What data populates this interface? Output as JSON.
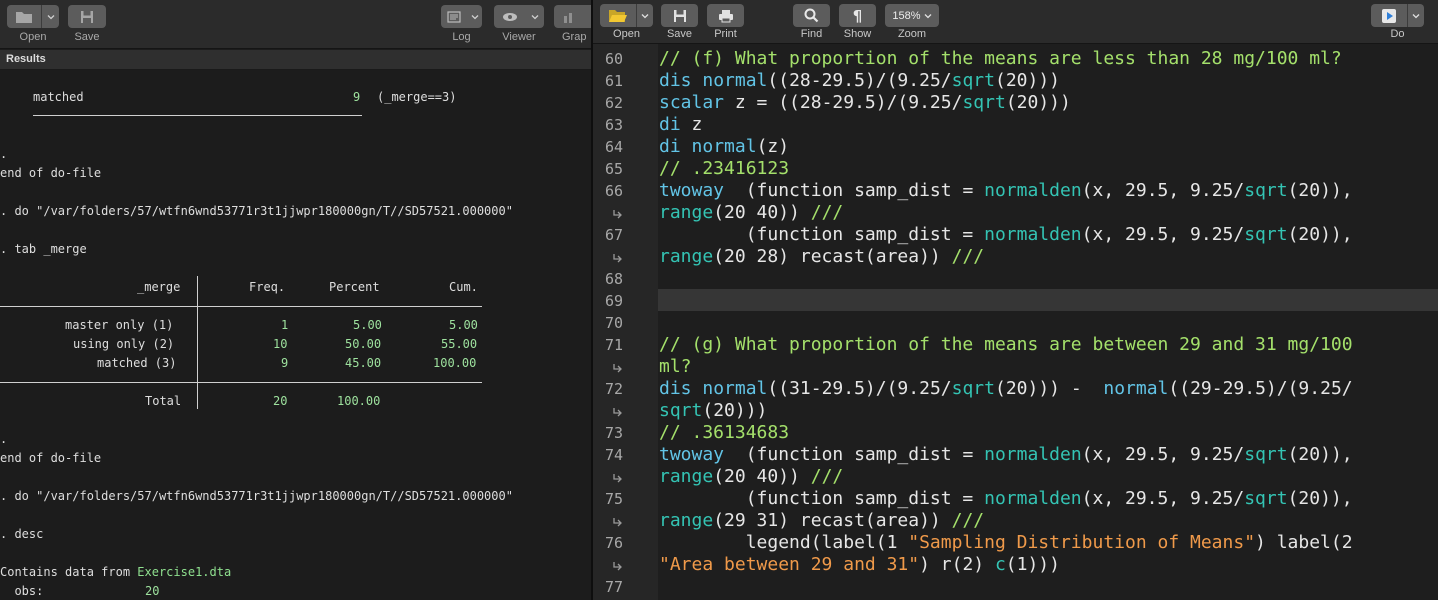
{
  "results_window": {
    "toolbar": {
      "open_label": "Open",
      "save_label": "Save",
      "log_label": "Log",
      "viewer_label": "Viewer",
      "graph_label": "Grap"
    },
    "results_header": "Results",
    "lines": {
      "merge_matched_label": "matched",
      "merge_matched_count": "9",
      "merge_matched_cond": "(_merge==3)",
      "dot1": ".",
      "end1": "end of do-file",
      "do1": ". do \"/var/folders/57/wtfn6wnd53771r3t1jjwpr180000gn/T//SD57521.000000\"",
      "tab_cmd": ". tab _merge",
      "dot2": ".",
      "end2": "end of do-file",
      "do2": ". do \"/var/folders/57/wtfn6wnd53771r3t1jjwpr180000gn/T//SD57521.000000\"",
      "desc_cmd": ". desc",
      "contains_prefix": "Contains data from ",
      "contains_file": "Exercise1.dta",
      "obs_label": "  obs:",
      "obs_value": "20"
    },
    "table": {
      "headers": [
        "_merge",
        "Freq.",
        "Percent",
        "Cum."
      ],
      "rows": [
        {
          "label": "master only (1)",
          "freq": "1",
          "percent": "5.00",
          "cum": "5.00"
        },
        {
          "label": "using only (2)",
          "freq": "10",
          "percent": "50.00",
          "cum": "55.00"
        },
        {
          "label": "matched (3)",
          "freq": "9",
          "percent": "45.00",
          "cum": "100.00"
        }
      ],
      "total": {
        "label": "Total",
        "freq": "20",
        "percent": "100.00"
      }
    }
  },
  "dofile_editor": {
    "toolbar": {
      "open_label": "Open",
      "save_label": "Save",
      "print_label": "Print",
      "find_label": "Find",
      "show_label": "Show",
      "zoom_label": "Zoom",
      "zoom_value": "158%",
      "do_label": "Do"
    },
    "line_numbers": [
      "60",
      "61",
      "62",
      "63",
      "64",
      "65",
      "66",
      "67",
      "68",
      "69",
      "70",
      "71",
      "72",
      "73",
      "74",
      "75",
      "76",
      "77"
    ],
    "code": {
      "l60": "// (f) What proportion of the means are less than 28 mg/100 ml?",
      "l61_a": "dis",
      "l61_b": " ",
      "l61_c": "normal",
      "l61_d": "((28-29.5)/(9.25/",
      "l61_e": "sqrt",
      "l61_f": "(20)))",
      "l62_a": "scalar",
      "l62_b": " z = ((28-29.5)/(9.25/",
      "l62_c": "sqrt",
      "l62_d": "(20)))",
      "l63_a": "di",
      "l63_b": " z",
      "l64_a": "di",
      "l64_b": " ",
      "l64_c": "normal",
      "l64_d": "(z)",
      "l65": "// .23416123",
      "l66_a": "twoway",
      "l66_b": "  (function samp_dist = ",
      "l66_c": "normalden",
      "l66_d": "(x, 29.5, 9.25/",
      "l66_e": "sqrt",
      "l66_f": "(20)),",
      "l66w_a": "range",
      "l66w_b": "(20 40)) ",
      "l66w_c": "///",
      "l67_a": "        (function samp_dist = ",
      "l67_b": "normalden",
      "l67_c": "(x, 29.5, 9.25/",
      "l67_d": "sqrt",
      "l67_e": "(20)),",
      "l67w_a": "range",
      "l67w_b": "(20 28) recast(area)) ",
      "l67w_c": "///",
      "l71": "// (g) What proportion of the means are between 29 and 31 mg/100",
      "l71w": "ml?",
      "l72_a": "dis",
      "l72_b": " ",
      "l72_c": "normal",
      "l72_d": "((31-29.5)/(9.25/",
      "l72_e": "sqrt",
      "l72_f": "(20))) -  ",
      "l72_g": "normal",
      "l72_h": "((29-29.5)/(9.25/",
      "l72w_a": "sqrt",
      "l72w_b": "(20)))",
      "l73": "// .36134683",
      "l74_a": "twoway",
      "l74_b": "  (function samp_dist = ",
      "l74_c": "normalden",
      "l74_d": "(x, 29.5, 9.25/",
      "l74_e": "sqrt",
      "l74_f": "(20)),",
      "l74w_a": "range",
      "l74w_b": "(20 40)) ",
      "l74w_c": "///",
      "l75_a": "        (function samp_dist = ",
      "l75_b": "normalden",
      "l75_c": "(x, 29.5, 9.25/",
      "l75_d": "sqrt",
      "l75_e": "(20)),",
      "l75w_a": "range",
      "l75w_b": "(29 31) recast(area)) ",
      "l75w_c": "///",
      "l76_a": "        legend(label(1 ",
      "l76_b": "\"Sampling Distribution of Means\"",
      "l76_c": ") label(2",
      "l76w_a": "\"Area between 29 and 31\"",
      "l76w_b": ") r(2) ",
      "l76w_c": "c",
      "l76w_d": "(1)))"
    }
  },
  "colors": {
    "comment": "#a4e06b",
    "keyword": "#62c4e6",
    "function": "#34c4b4",
    "string": "#f09a4a",
    "output_number": "#9ee29e"
  }
}
